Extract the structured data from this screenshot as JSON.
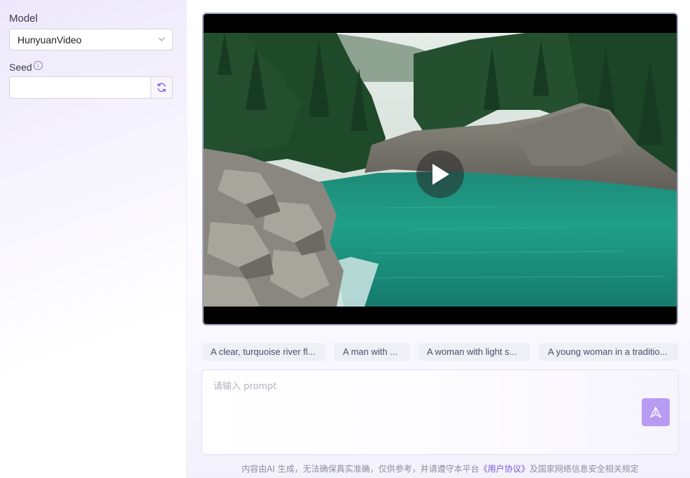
{
  "sidebar": {
    "model_label": "Model",
    "model_value": "HunyuanVideo",
    "seed_label": "Seed",
    "seed_value": "",
    "icons": {
      "info": "info-icon",
      "chevron": "chevron-down-icon",
      "refresh": "refresh-icon"
    }
  },
  "video": {
    "play_icon": "play-icon"
  },
  "suggestions": [
    "A clear, turquoise river fl...",
    "A man with ...",
    "A woman with light s...",
    "A young woman in a traditio..."
  ],
  "prompt": {
    "placeholder": "请输入 prompt",
    "value": "",
    "send_icon": "send-icon"
  },
  "disclaimer": {
    "prefix": "内容由AI 生成，无法确保真实准确，仅供参考，并请遵守本平台",
    "link": "《用户协议》",
    "suffix": "及国家网络信息安全相关规定"
  },
  "colors": {
    "accent": "#b79cf2",
    "link": "#7c56d8",
    "chip_bg": "#eef0f6"
  }
}
